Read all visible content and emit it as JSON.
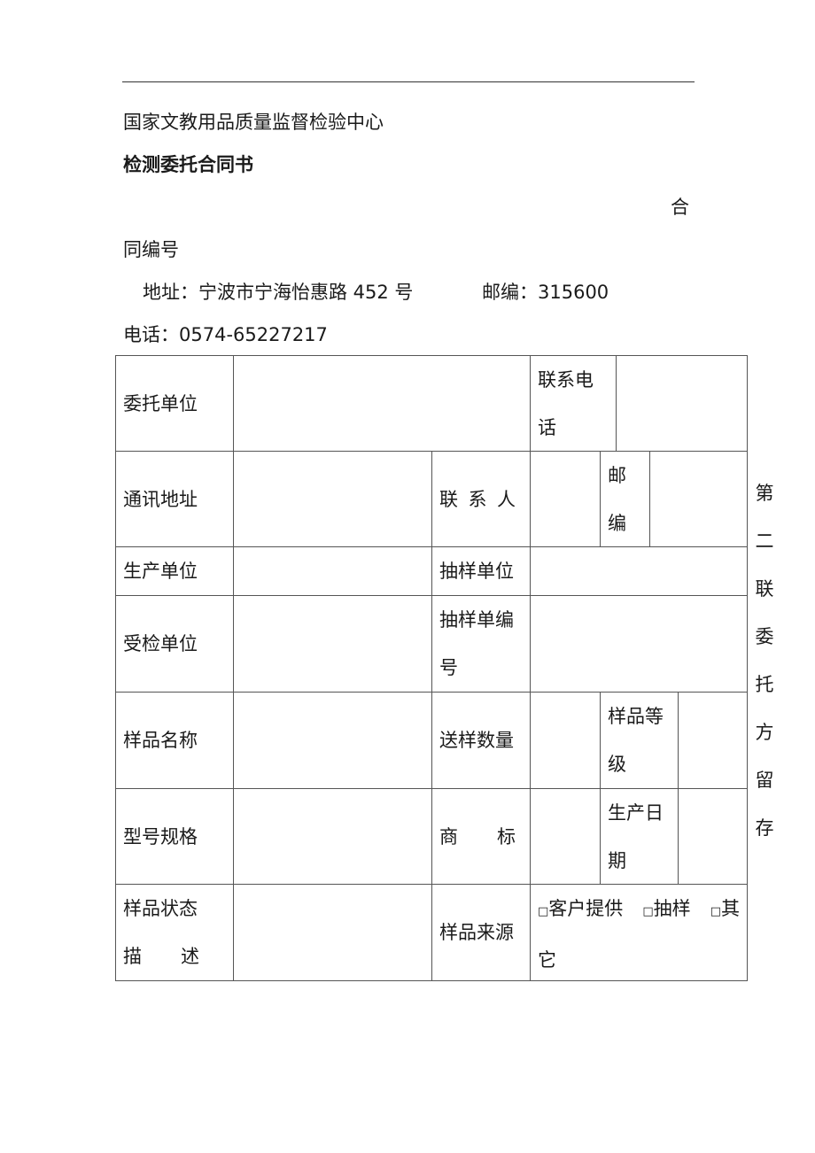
{
  "header": {
    "org_name": "国家文教用品质量监督检验中心",
    "doc_title": "检测委托合同书",
    "contract_no_label_part1": "合",
    "contract_no_label_part2": "同编号",
    "address_label": "地址：宁波市宁海怡惠路 452 号",
    "postcode_label": "邮编：315600",
    "phone_label": "电话：0574-65227217"
  },
  "table": {
    "client_unit": "委托单位",
    "contact_phone_1": "联系电",
    "contact_phone_2": "话",
    "mail_address": "通讯地址",
    "contact_person": [
      "联",
      "系",
      "人"
    ],
    "postcode_1": "邮",
    "postcode_2": "编",
    "producer": "生产单位",
    "sampling_unit": "抽样单位",
    "inspected_unit": "受检单位",
    "sampling_no_1": "抽样单编",
    "sampling_no_2": "号",
    "sample_name": "样品名称",
    "sample_qty": "送样数量",
    "sample_grade_1": "样品等",
    "sample_grade_2": "级",
    "model_spec": "型号规格",
    "trademark": [
      "商",
      "标"
    ],
    "prod_date_1": "生产日",
    "prod_date_2": "期",
    "sample_state_1": "样品状态",
    "sample_state_2": [
      "描",
      "述"
    ],
    "sample_source": "样品来源",
    "source_options": {
      "opt1": "客户提供",
      "opt2": "抽样",
      "opt3_part1": "其",
      "opt3_part2": "它"
    }
  },
  "side_note": [
    "第",
    "二",
    "联",
    "委",
    "托",
    "方",
    "留",
    "存"
  ]
}
